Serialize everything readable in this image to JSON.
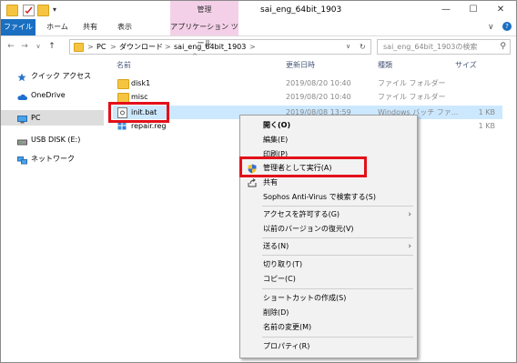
{
  "title_bar": {
    "contextual_group": "管理",
    "window_title": "sai_eng_64bit_1903",
    "minimize": "—",
    "maximize": "☐",
    "close": "✕"
  },
  "ribbon": {
    "tabs": [
      "ファイル",
      "ホーム",
      "共有",
      "表示",
      "アプリケーション ツール"
    ]
  },
  "address": {
    "back": "←",
    "forward": "→",
    "recent": "∨",
    "up": "↑",
    "crumbs": [
      "PC",
      "ダウンロード",
      "sai_eng_64bit_1903"
    ],
    "sep": ">",
    "dropdown": "∨",
    "refresh": "↻",
    "search_placeholder": "sai_eng_64bit_1903の検索",
    "search_icon": "⚲"
  },
  "nav": {
    "items": [
      {
        "label": "クイック アクセス",
        "icon": "star-icon"
      },
      {
        "label": "OneDrive",
        "icon": "cloud-icon"
      },
      {
        "label": "PC",
        "icon": "computer-icon",
        "selected": true
      },
      {
        "label": "USB DISK (E:)",
        "icon": "usb-drive-icon"
      },
      {
        "label": "ネットワーク",
        "icon": "network-icon"
      }
    ]
  },
  "columns": {
    "name": "名前",
    "date": "更新日時",
    "type": "種類",
    "size": "サイズ",
    "sort_arrow": "^"
  },
  "files": [
    {
      "name": "disk1",
      "date": "2019/08/20 10:40",
      "type": "ファイル フォルダー",
      "size": "",
      "icon": "folder-icon"
    },
    {
      "name": "misc",
      "date": "2019/08/20 10:40",
      "type": "ファイル フォルダー",
      "size": "",
      "icon": "folder-icon"
    },
    {
      "name": "init.bat",
      "date": "2019/08/08 13:59",
      "type": "Windows バッチ ファ...",
      "size": "1 KB",
      "icon": "batch-file-icon",
      "selected": true
    },
    {
      "name": "repair.reg",
      "date": "",
      "type": "",
      "size": "1 KB",
      "icon": "registry-file-icon"
    }
  ],
  "context_menu": {
    "items": [
      {
        "label": "開く(O)",
        "bold": true
      },
      {
        "label": "編集(E)"
      },
      {
        "label": "印刷(P)"
      },
      {
        "label": "管理者として実行(A)",
        "icon": "uac-shield-icon"
      },
      {
        "label": "共有",
        "icon": "share-icon"
      },
      {
        "label": "Sophos Anti-Virus で検索する(S)"
      },
      {
        "label": "アクセスを許可する(G)",
        "submenu": true
      },
      {
        "label": "以前のバージョンの復元(V)"
      },
      {
        "label": "送る(N)",
        "submenu": true
      },
      {
        "label": "切り取り(T)"
      },
      {
        "label": "コピー(C)"
      },
      {
        "label": "ショートカットの作成(S)"
      },
      {
        "label": "削除(D)"
      },
      {
        "label": "名前の変更(M)"
      },
      {
        "label": "プロパティ(R)"
      }
    ],
    "submenu_arrow": "›"
  },
  "highlight_color": "#e3101a"
}
